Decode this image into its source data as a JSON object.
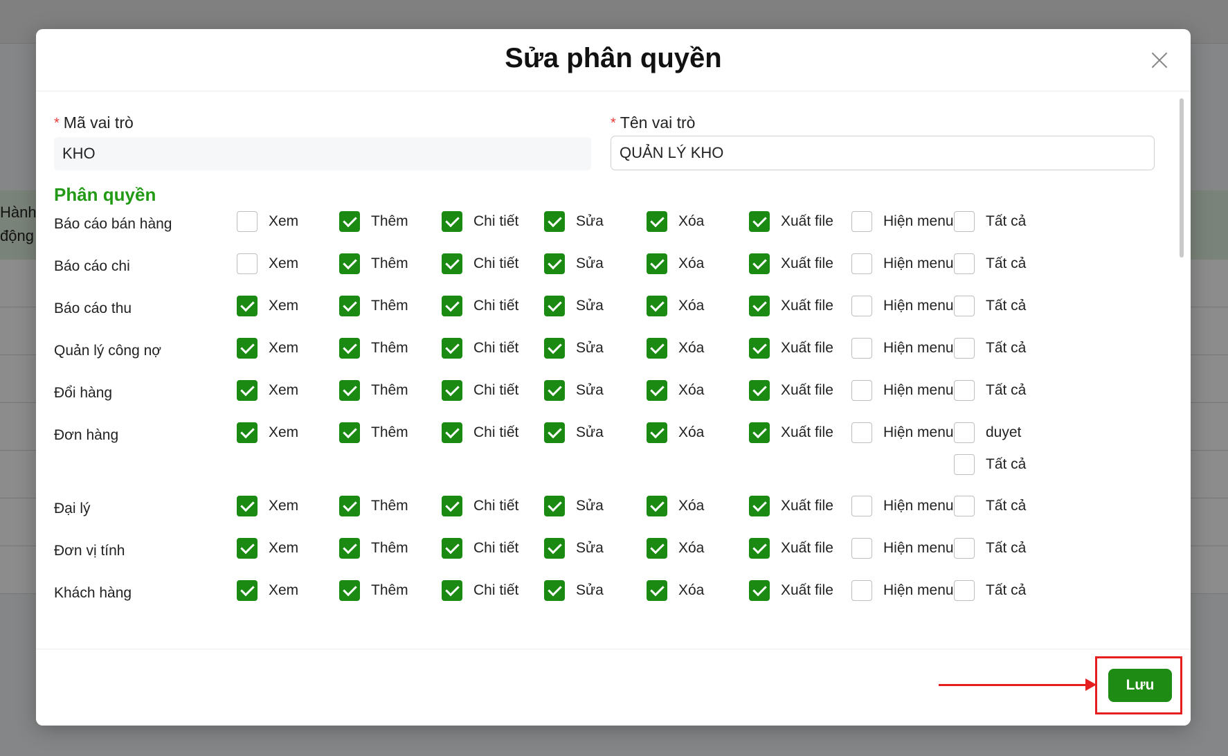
{
  "background": {
    "header_line1": "Hành",
    "header_line2": "động"
  },
  "modal": {
    "title": "Sửa phân quyền",
    "fields": {
      "code_label": "Mã vai trò",
      "code_value": "KHO",
      "name_label": "Tên vai trò",
      "name_value": "QUẢN LÝ KHO"
    },
    "section_title": "Phân quyền",
    "rows": [
      {
        "name": "Báo cáo bán hàng",
        "perms": [
          {
            "label": "Xem",
            "checked": false
          },
          {
            "label": "Thêm",
            "checked": true
          },
          {
            "label": "Chi tiết",
            "checked": true
          },
          {
            "label": "Sửa",
            "checked": true
          },
          {
            "label": "Xóa",
            "checked": true
          },
          {
            "label": "Xuất file",
            "checked": true
          },
          {
            "label": "Hiện menu",
            "checked": false
          },
          {
            "label": "Tất cả",
            "checked": false
          }
        ]
      },
      {
        "name": "Báo cáo chi",
        "perms": [
          {
            "label": "Xem",
            "checked": false
          },
          {
            "label": "Thêm",
            "checked": true
          },
          {
            "label": "Chi tiết",
            "checked": true
          },
          {
            "label": "Sửa",
            "checked": true
          },
          {
            "label": "Xóa",
            "checked": true
          },
          {
            "label": "Xuất file",
            "checked": true
          },
          {
            "label": "Hiện menu",
            "checked": false
          },
          {
            "label": "Tất cả",
            "checked": false
          }
        ]
      },
      {
        "name": "Báo cáo thu",
        "perms": [
          {
            "label": "Xem",
            "checked": true
          },
          {
            "label": "Thêm",
            "checked": true
          },
          {
            "label": "Chi tiết",
            "checked": true
          },
          {
            "label": "Sửa",
            "checked": true
          },
          {
            "label": "Xóa",
            "checked": true
          },
          {
            "label": "Xuất file",
            "checked": true
          },
          {
            "label": "Hiện menu",
            "checked": false
          },
          {
            "label": "Tất cả",
            "checked": false
          }
        ]
      },
      {
        "name": "Quản lý công nợ",
        "perms": [
          {
            "label": "Xem",
            "checked": true
          },
          {
            "label": "Thêm",
            "checked": true
          },
          {
            "label": "Chi tiết",
            "checked": true
          },
          {
            "label": "Sửa",
            "checked": true
          },
          {
            "label": "Xóa",
            "checked": true
          },
          {
            "label": "Xuất file",
            "checked": true
          },
          {
            "label": "Hiện menu",
            "checked": false
          },
          {
            "label": "Tất cả",
            "checked": false
          }
        ]
      },
      {
        "name": "Đổi hàng",
        "perms": [
          {
            "label": "Xem",
            "checked": true
          },
          {
            "label": "Thêm",
            "checked": true
          },
          {
            "label": "Chi tiết",
            "checked": true
          },
          {
            "label": "Sửa",
            "checked": true
          },
          {
            "label": "Xóa",
            "checked": true
          },
          {
            "label": "Xuất file",
            "checked": true
          },
          {
            "label": "Hiện menu",
            "checked": false
          },
          {
            "label": "Tất cả",
            "checked": false
          }
        ]
      },
      {
        "name": "Đơn hàng",
        "perms": [
          {
            "label": "Xem",
            "checked": true
          },
          {
            "label": "Thêm",
            "checked": true
          },
          {
            "label": "Chi tiết",
            "checked": true
          },
          {
            "label": "Sửa",
            "checked": true
          },
          {
            "label": "Xóa",
            "checked": true
          },
          {
            "label": "Xuất file",
            "checked": true
          },
          {
            "label": "Hiện menu",
            "checked": false
          },
          {
            "label": "duyet",
            "checked": false
          },
          {
            "label": "Tất cả",
            "checked": false
          }
        ]
      },
      {
        "name": "Đại lý",
        "perms": [
          {
            "label": "Xem",
            "checked": true
          },
          {
            "label": "Thêm",
            "checked": true
          },
          {
            "label": "Chi tiết",
            "checked": true
          },
          {
            "label": "Sửa",
            "checked": true
          },
          {
            "label": "Xóa",
            "checked": true
          },
          {
            "label": "Xuất file",
            "checked": true
          },
          {
            "label": "Hiện menu",
            "checked": false
          },
          {
            "label": "Tất cả",
            "checked": false
          }
        ]
      },
      {
        "name": "Đơn vị tính",
        "perms": [
          {
            "label": "Xem",
            "checked": true
          },
          {
            "label": "Thêm",
            "checked": true
          },
          {
            "label": "Chi tiết",
            "checked": true
          },
          {
            "label": "Sửa",
            "checked": true
          },
          {
            "label": "Xóa",
            "checked": true
          },
          {
            "label": "Xuất file",
            "checked": true
          },
          {
            "label": "Hiện menu",
            "checked": false
          },
          {
            "label": "Tất cả",
            "checked": false
          }
        ]
      },
      {
        "name": "Khách hàng",
        "perms": [
          {
            "label": "Xem",
            "checked": true
          },
          {
            "label": "Thêm",
            "checked": true
          },
          {
            "label": "Chi tiết",
            "checked": true
          },
          {
            "label": "Sửa",
            "checked": true
          },
          {
            "label": "Xóa",
            "checked": true
          },
          {
            "label": "Xuất file",
            "checked": true
          },
          {
            "label": "Hiện menu",
            "checked": false
          },
          {
            "label": "Tất cả",
            "checked": false
          }
        ]
      }
    ],
    "save_label": "Lưu"
  },
  "colors": {
    "accent_green": "#1a8a12",
    "section_green": "#229a16",
    "annotation_red": "#e51f1f"
  }
}
